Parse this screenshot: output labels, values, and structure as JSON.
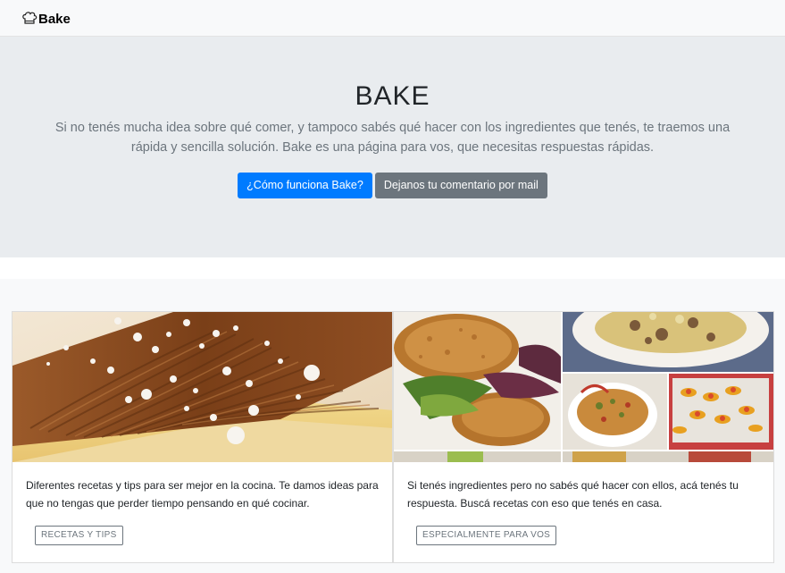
{
  "navbar": {
    "brand_label": "Bake",
    "brand_icon": "chef-hat-icon"
  },
  "hero": {
    "title": "BAKE",
    "lead": "Si no tenés mucha idea sobre qué comer, y tampoco sabés qué hacer con los ingredientes que tenés, te traemos una rápida y sencilla solución. Bake es una página para vos, que necesitas respuestas rápidas.",
    "primary_button": "¿Cómo funciona Bake?",
    "secondary_button": "Dejanos tu comentario por mail"
  },
  "cards": [
    {
      "image": "dessert-photo",
      "text": "Diferentes recetas y tips para ser mejor en la cocina. Te damos ideas para que no tengas que perder tiempo pensando en qué cocinar.",
      "button": "RECETAS Y TIPS"
    },
    {
      "image": "food-collage-photo",
      "text": "Si tenés ingredientes pero no sabés qué hacer con ellos, acá tenés tu respuesta. Buscá recetas con eso que tenés en casa.",
      "button": "ESPECIALMENTE PARA VOS"
    }
  ],
  "colors": {
    "primary": "#007bff",
    "secondary": "#6c757d",
    "hero_bg": "#e9ecef",
    "page_bg": "#f8f9fa"
  }
}
